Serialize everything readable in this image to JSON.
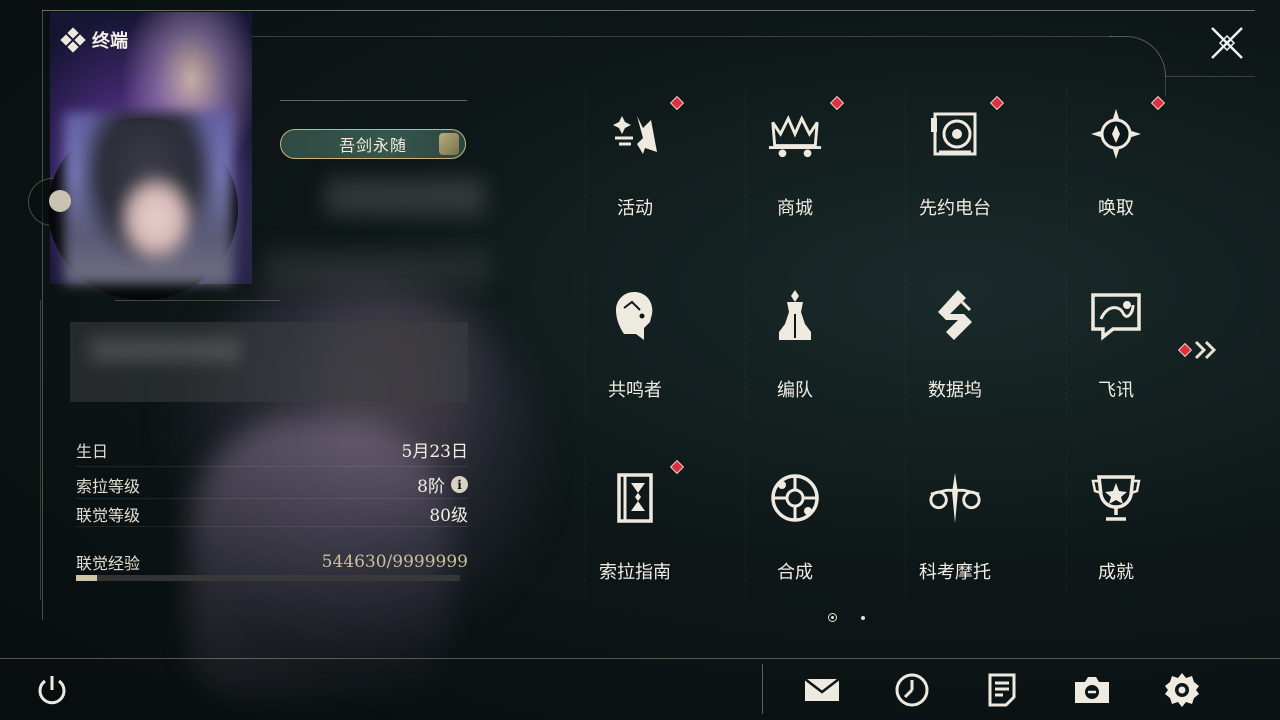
{
  "header": {
    "title": "终端"
  },
  "profile": {
    "title_badge": "吾剑永随"
  },
  "stats": {
    "birthday_label": "生日",
    "birthday_value": "5月23日",
    "sola_level_label": "索拉等级",
    "sola_level_value": "8阶",
    "union_level_label": "联觉等级",
    "union_level_value": "80级",
    "union_exp_label": "联觉经验",
    "union_exp_value": "544630/9999999",
    "union_exp_progress": 0.0545
  },
  "menu": {
    "items": [
      {
        "label": "活动",
        "icon": "activity-icon",
        "badge": true
      },
      {
        "label": "商城",
        "icon": "shop-icon",
        "badge": true
      },
      {
        "label": "先约电台",
        "icon": "radio-icon",
        "badge": true
      },
      {
        "label": "唤取",
        "icon": "summon-icon",
        "badge": true
      },
      {
        "label": "共鸣者",
        "icon": "resonator-icon",
        "badge": false
      },
      {
        "label": "编队",
        "icon": "team-icon",
        "badge": false
      },
      {
        "label": "数据坞",
        "icon": "databank-icon",
        "badge": false
      },
      {
        "label": "飞讯",
        "icon": "message-icon",
        "badge": false
      },
      {
        "label": "索拉指南",
        "icon": "guidebook-icon",
        "badge": true
      },
      {
        "label": "合成",
        "icon": "synthesis-icon",
        "badge": false
      },
      {
        "label": "科考摩托",
        "icon": "motorcycle-icon",
        "badge": false
      },
      {
        "label": "成就",
        "icon": "achievement-icon",
        "badge": false
      }
    ],
    "pages": 2,
    "current_page": 1
  },
  "bottom_bar": {
    "buttons": [
      "power-icon",
      "mail-icon",
      "compass-icon",
      "notice-icon",
      "camera-icon",
      "settings-icon"
    ]
  },
  "colors": {
    "accent_gold": "#c9b37a",
    "badge_red": "#d8313f",
    "background": "#0e1718"
  }
}
